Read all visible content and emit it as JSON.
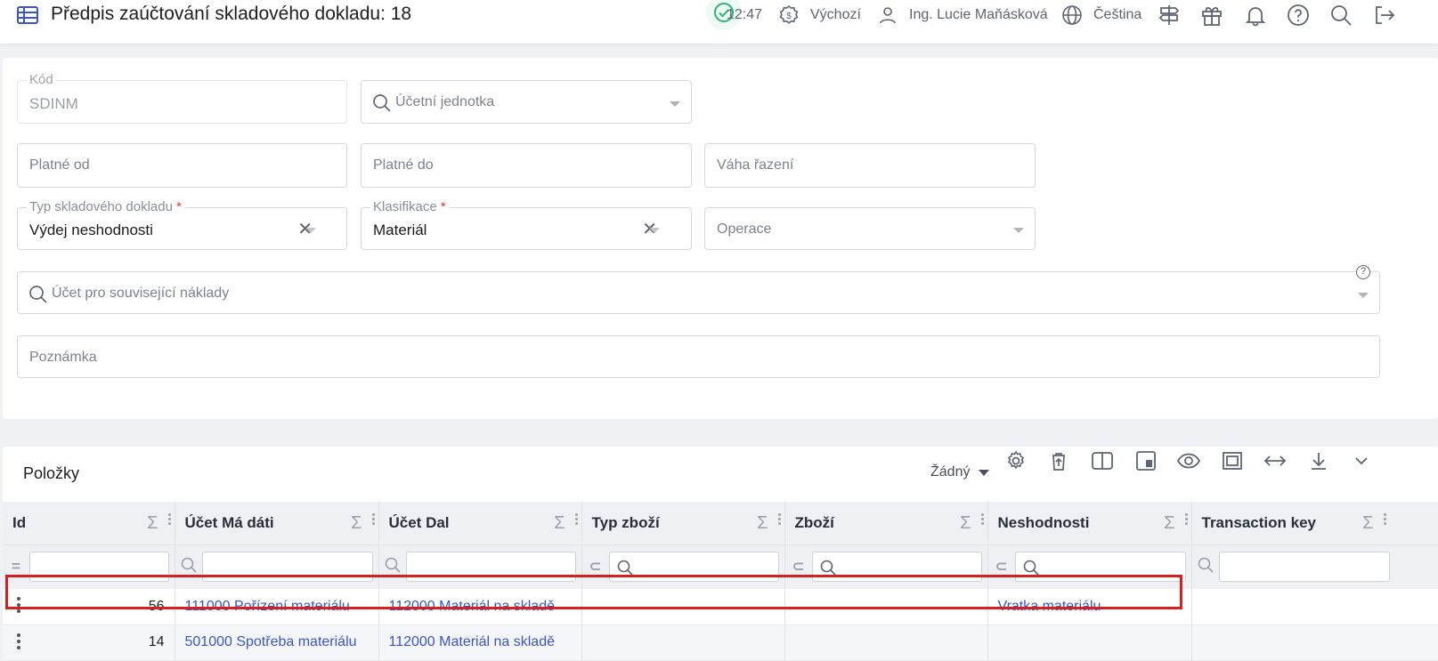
{
  "header": {
    "title": "Předpis zaúčtování skladového dokladu: 18",
    "time": "12:47",
    "currency_profile": "Výchozí",
    "user": "Ing. Lucie Maňásková",
    "language": "Čeština",
    "icons": [
      "table-icon",
      "status-ok-icon",
      "currency-icon",
      "user-icon",
      "globe-icon",
      "signpost-icon",
      "gift-icon",
      "bell-icon",
      "help-icon",
      "search-icon",
      "logout-icon"
    ],
    "status_color": "#2bb673"
  },
  "form": {
    "kod": {
      "label": "Kód",
      "value": "SDINM"
    },
    "ucetni_jednotka": {
      "placeholder": "Účetní jednotka"
    },
    "platne_od": {
      "placeholder": "Platné od"
    },
    "platne_do": {
      "placeholder": "Platné do"
    },
    "vaha_razeni": {
      "placeholder": "Váha řazení"
    },
    "typ_dokladu": {
      "label": "Typ skladového dokladu",
      "required": "*",
      "value": "Výdej neshodnosti"
    },
    "klasifikace": {
      "label": "Klasifikace",
      "required": "*",
      "value": "Materiál"
    },
    "operace": {
      "placeholder": "Operace"
    },
    "ucet_naklady": {
      "placeholder": "Účet pro související náklady",
      "help": "?"
    },
    "poznamka": {
      "placeholder": "Poznámka"
    },
    "clear_glyph": "✕"
  },
  "grid": {
    "title": "Položky",
    "grouping": "Žádný",
    "sigma": "Σ",
    "filter_prefix_eq": "=",
    "filter_prefix_subset": "⊂",
    "columns": [
      "Id",
      "Účet Má dáti",
      "Účet Dal",
      "Typ zboží",
      "Zboží",
      "Neshodnosti",
      "Transaction key"
    ],
    "rows": [
      {
        "id": "56",
        "md": "111000 Pořízení materiálu",
        "dal": "112000 Materiál na skladě",
        "typ": "",
        "zbozi": "",
        "neshodnosti": "Vratka materiálu",
        "tkey": ""
      },
      {
        "id": "14",
        "md": "501000 Spotřeba materiálu",
        "dal": "112000 Materiál na skladě",
        "typ": "",
        "zbozi": "",
        "neshodnosti": "",
        "tkey": ""
      }
    ],
    "accent_color": "#3a55c8",
    "highlight_color": "#d62020"
  }
}
